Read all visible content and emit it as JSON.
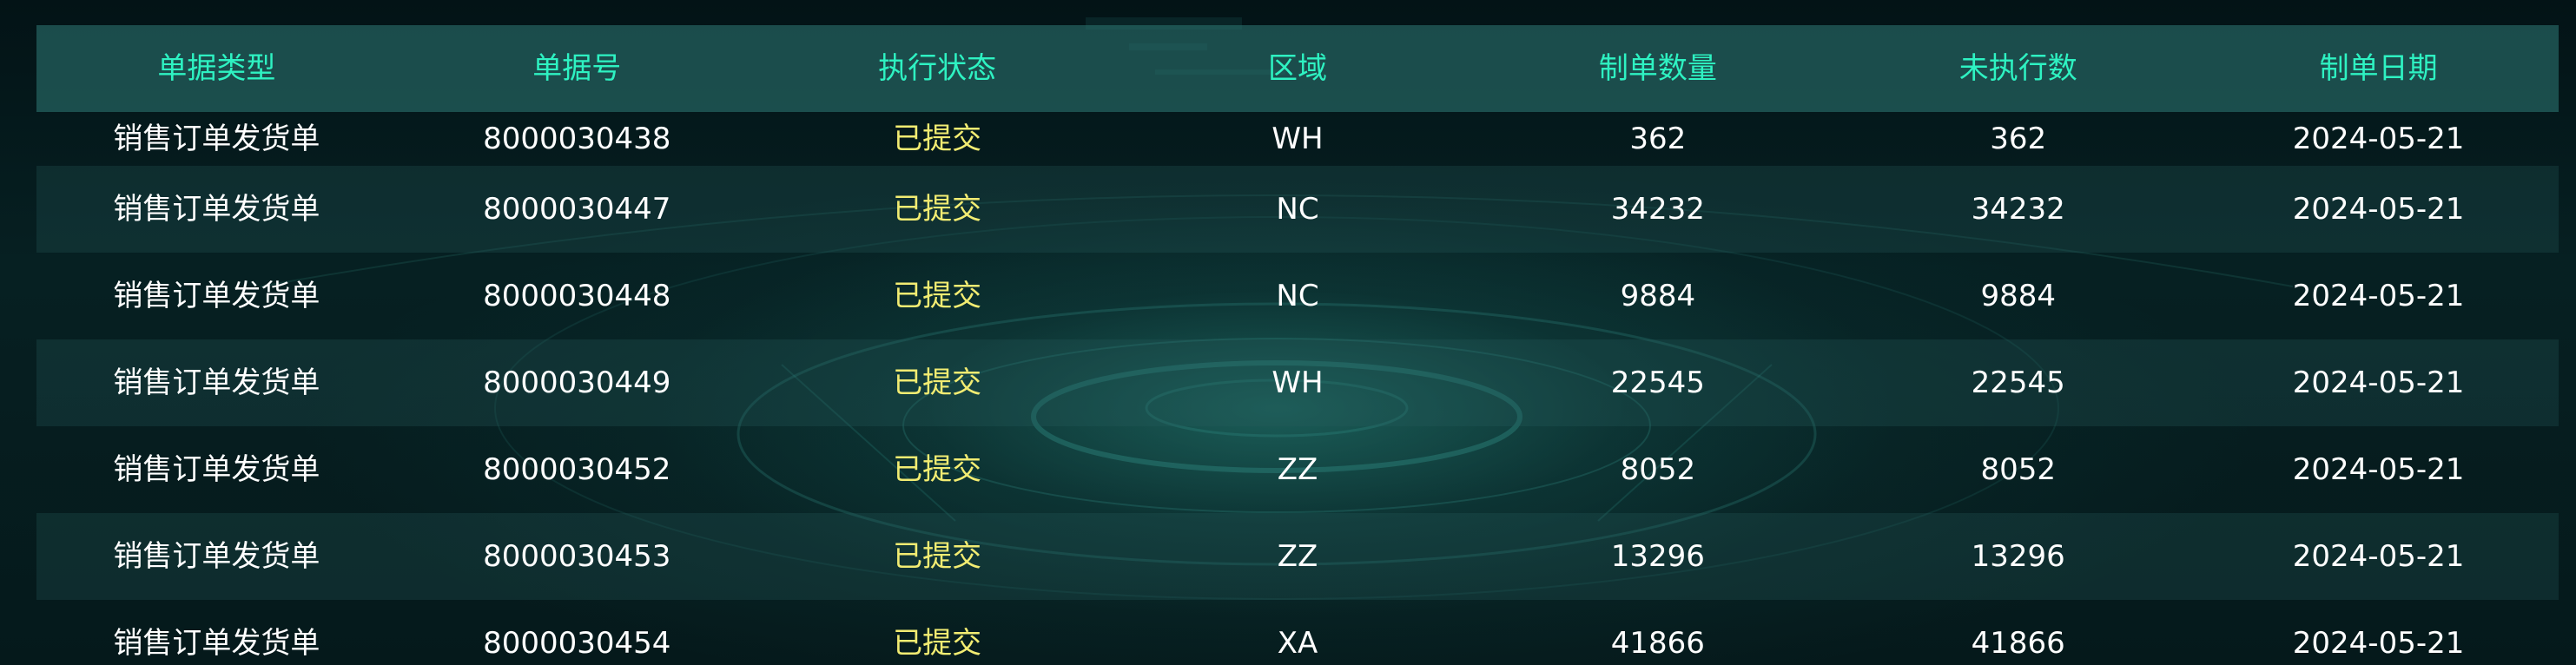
{
  "table": {
    "headers": [
      "单据类型",
      "单据号",
      "执行状态",
      "区域",
      "制单数量",
      "未执行数",
      "制单日期"
    ],
    "rows": [
      {
        "type": "销售订单发货单",
        "number": "8000030438",
        "status": "已提交",
        "region": "WH",
        "qty": "362",
        "unexecuted": "362",
        "date": "2024-05-21"
      },
      {
        "type": "销售订单发货单",
        "number": "8000030447",
        "status": "已提交",
        "region": "NC",
        "qty": "34232",
        "unexecuted": "34232",
        "date": "2024-05-21"
      },
      {
        "type": "销售订单发货单",
        "number": "8000030448",
        "status": "已提交",
        "region": "NC",
        "qty": "9884",
        "unexecuted": "9884",
        "date": "2024-05-21"
      },
      {
        "type": "销售订单发货单",
        "number": "8000030449",
        "status": "已提交",
        "region": "WH",
        "qty": "22545",
        "unexecuted": "22545",
        "date": "2024-05-21"
      },
      {
        "type": "销售订单发货单",
        "number": "8000030452",
        "status": "已提交",
        "region": "ZZ",
        "qty": "8052",
        "unexecuted": "8052",
        "date": "2024-05-21"
      },
      {
        "type": "销售订单发货单",
        "number": "8000030453",
        "status": "已提交",
        "region": "ZZ",
        "qty": "13296",
        "unexecuted": "13296",
        "date": "2024-05-21"
      },
      {
        "type": "销售订单发货单",
        "number": "8000030454",
        "status": "已提交",
        "region": "XA",
        "qty": "41866",
        "unexecuted": "41866",
        "date": "2024-05-21"
      }
    ]
  },
  "colors": {
    "header_text": "#2ef2c2",
    "status_text": "#f2ec72",
    "cell_text": "#ffffff",
    "header_bg": "#2a706c"
  }
}
